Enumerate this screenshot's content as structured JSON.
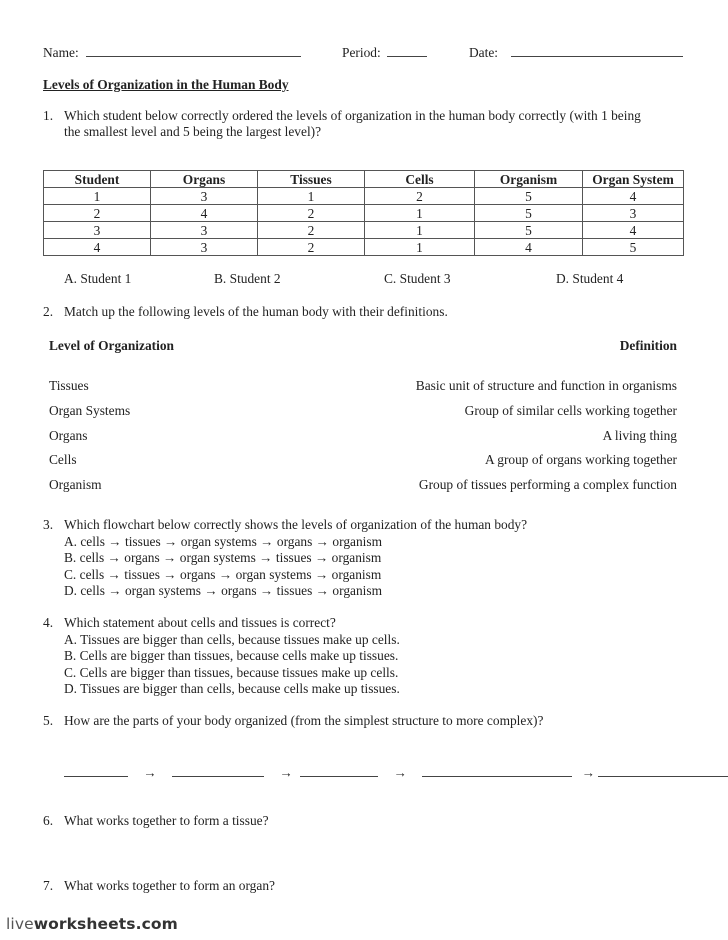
{
  "header": {
    "name_label": "Name:",
    "period_label": "Period:",
    "date_label": "Date:"
  },
  "title": "Levels of Organization in the Human Body",
  "q1": {
    "number": "1.",
    "text_line1": "Which student below correctly ordered the levels of organization in the human body correctly (with 1 being",
    "text_line2": "the smallest level and 5 being the largest level)?",
    "table": {
      "headers": [
        "Student",
        "Organs",
        "Tissues",
        "Cells",
        "Organism",
        "Organ System"
      ],
      "rows": [
        [
          "1",
          "3",
          "1",
          "2",
          "5",
          "4"
        ],
        [
          "2",
          "4",
          "2",
          "1",
          "5",
          "3"
        ],
        [
          "3",
          "3",
          "2",
          "1",
          "5",
          "4"
        ],
        [
          "4",
          "3",
          "2",
          "1",
          "4",
          "5"
        ]
      ]
    },
    "options": [
      "A.  Student 1",
      "B.  Student 2",
      "C.  Student 3",
      "D.  Student 4"
    ]
  },
  "q2": {
    "number": "2.",
    "text": "Match up the following levels of the human body with their definitions.",
    "left_header": "Level of Organization",
    "right_header": "Definition",
    "levels": [
      "Tissues",
      "Organ Systems",
      "Organs",
      "Cells",
      "Organism"
    ],
    "definitions": [
      "Basic unit of structure and function in organisms",
      "Group of similar cells working together",
      "A living thing",
      "A group of organs working together",
      "Group of tissues performing a complex function"
    ]
  },
  "q3": {
    "number": "3.",
    "text": "Which flowchart below correctly shows the levels of organization of the human body?",
    "options": [
      "A.  cells → tissues → organ systems → organs → organism",
      "B.  cells → organs → organ systems → tissues → organism",
      "C.  cells → tissues → organs → organ systems → organism",
      "D.  cells → organ systems → organs → tissues → organism"
    ]
  },
  "q4": {
    "number": "4.",
    "text": "Which statement about cells and tissues is correct?",
    "options": [
      "A.  Tissues are bigger than cells, because tissues make up cells.",
      "B.  Cells are bigger than tissues, because cells make up tissues.",
      "C.  Cells are bigger than tissues, because tissues make up cells.",
      "D.  Tissues are bigger than cells, because cells make up tissues."
    ]
  },
  "q5": {
    "number": "5.",
    "text": "How are the parts of your body organized (from the simplest structure to more complex)?",
    "arrow": "→"
  },
  "q6": {
    "number": "6.",
    "text": "What works together to form a tissue?"
  },
  "q7": {
    "number": "7.",
    "text": "What works together to form an organ?"
  },
  "footer": {
    "brand_light": "live",
    "brand_bold": "worksheets.com"
  }
}
